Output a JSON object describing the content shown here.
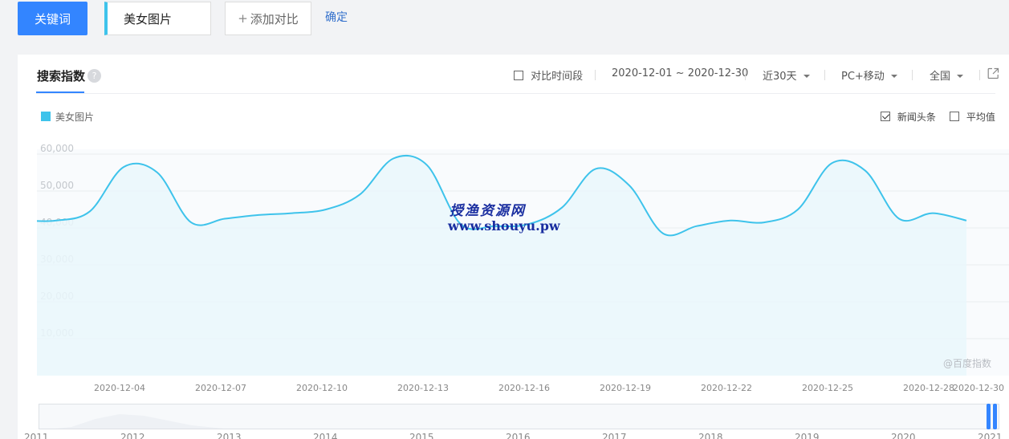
{
  "topbar": {
    "keyword_button": "关键词",
    "keyword_value": "美女图片",
    "add_compare": "添加对比",
    "confirm": "确定"
  },
  "panel": {
    "tab_title": "搜索指数",
    "help": "?",
    "compare_period": "对比时间段",
    "date_range": "2020-12-01 ~ 2020-12-30",
    "period": "近30天",
    "device": "PC+移动",
    "region": "全国",
    "legend": "美女图片",
    "news_option": "新闻头条",
    "average_option": "平均值",
    "watermark_cn": "授渔资源网",
    "watermark_url": "www.shouyu.pw",
    "credit": "@百度指数"
  },
  "colors": {
    "series": "#3ec3eb",
    "accent": "#3385ff"
  },
  "icons": {
    "help": "question-icon",
    "export": "export-icon",
    "dropdown": "caret-down-icon"
  },
  "chart_data": {
    "type": "area",
    "ylim": [
      0,
      60000
    ],
    "yticks": [
      "60,000",
      "50,000",
      "40,000",
      "30,000",
      "20,000",
      "10,000"
    ],
    "ytick_values": [
      60000,
      50000,
      40000,
      30000,
      20000,
      10000
    ],
    "x_dates": [
      "2020-12-01",
      "2020-12-02",
      "2020-12-03",
      "2020-12-04",
      "2020-12-05",
      "2020-12-06",
      "2020-12-07",
      "2020-12-08",
      "2020-12-09",
      "2020-12-10",
      "2020-12-11",
      "2020-12-12",
      "2020-12-13",
      "2020-12-14",
      "2020-12-15",
      "2020-12-16",
      "2020-12-17",
      "2020-12-18",
      "2020-12-19",
      "2020-12-20",
      "2020-12-21",
      "2020-12-22",
      "2020-12-23",
      "2020-12-24",
      "2020-12-25",
      "2020-12-26",
      "2020-12-27",
      "2020-12-28",
      "2020-12-29",
      "2020-12-30"
    ],
    "xtick_labels": [
      "2020-12-04",
      "2020-12-07",
      "2020-12-10",
      "2020-12-13",
      "2020-12-16",
      "2020-12-19",
      "2020-12-22",
      "2020-12-25",
      "2020-12-28",
      "2020-12-30"
    ],
    "series": [
      {
        "values": [
          42000,
          42000,
          42000,
          44500,
          56500,
          55000,
          41500,
          42500,
          43500,
          44000,
          45000,
          49000,
          58800,
          57000,
          41000,
          40500,
          41000,
          45500,
          56000,
          51500,
          38500,
          40500,
          42000,
          41500,
          45000,
          57500,
          55500,
          42500,
          44000,
          42000
        ]
      }
    ],
    "grid": true,
    "range_years": [
      "2011",
      "2012",
      "2013",
      "2014",
      "2015",
      "2016",
      "2017",
      "2018",
      "2019",
      "2020",
      "2021"
    ]
  }
}
